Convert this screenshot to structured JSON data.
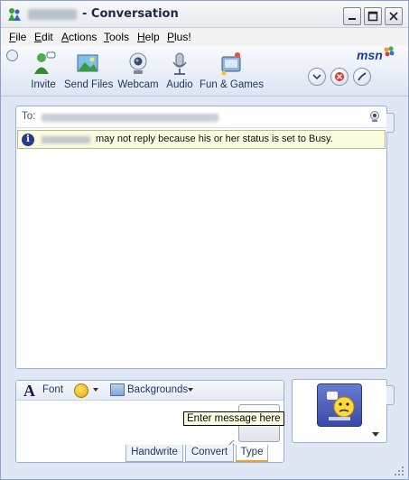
{
  "window": {
    "title": "- Conversation"
  },
  "menu": [
    {
      "label": "File",
      "accel": "F"
    },
    {
      "label": "Edit",
      "accel": "E"
    },
    {
      "label": "Actions",
      "accel": "A"
    },
    {
      "label": "Tools",
      "accel": "T"
    },
    {
      "label": "Help",
      "accel": "H"
    },
    {
      "label": "Plus!",
      "accel": "P"
    }
  ],
  "toolbar": {
    "invite": "Invite",
    "send_files": "Send Files",
    "webcam": "Webcam",
    "audio": "Audio",
    "fun_games": "Fun & Games",
    "logo": "msn"
  },
  "conversation": {
    "to_label": "To:",
    "notice": "may not reply because his or her status is set to Busy."
  },
  "compose": {
    "font_label": "Font",
    "backgrounds_label": "Backgrounds",
    "tooltip": "Enter message here",
    "message_value": ""
  },
  "modes": {
    "handwrite": "Handwrite",
    "convert": "Convert",
    "type": "Type",
    "active": "Type"
  },
  "colors": {
    "title_text": "#1c2a44",
    "accent_blue": "#1e3c98",
    "notice_bg": "#fbfbe0",
    "tooltip_bg": "#ffffe1",
    "active_tab_underline": "#f0a030"
  }
}
